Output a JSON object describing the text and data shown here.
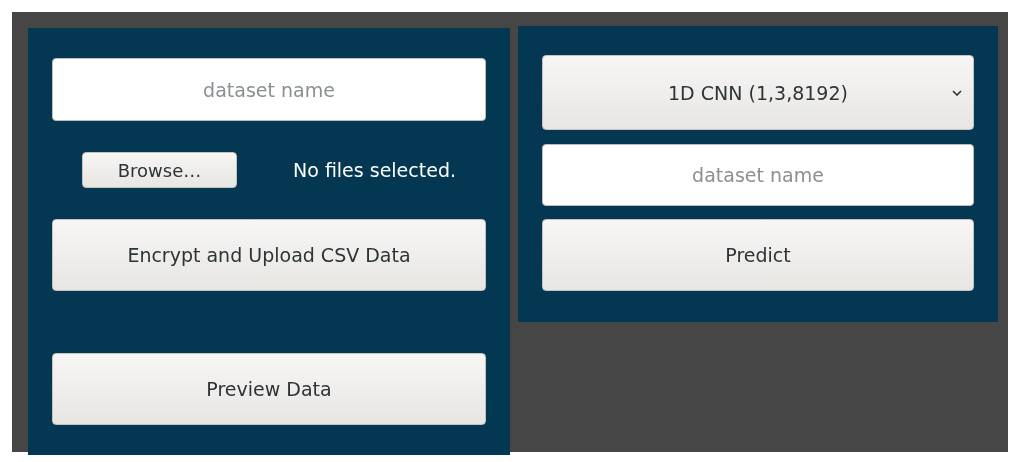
{
  "upload_panel": {
    "dataset_field": {
      "placeholder": "dataset name"
    },
    "browse_button": "Browse…",
    "file_status": "No files selected.",
    "upload_button": "Encrypt and Upload CSV Data",
    "preview_button": "Preview Data"
  },
  "predict_panel": {
    "model_select": {
      "value": "1D CNN (1,3,8192)"
    },
    "dataset_field": {
      "placeholder": "dataset name"
    },
    "predict_button": "Predict"
  }
}
